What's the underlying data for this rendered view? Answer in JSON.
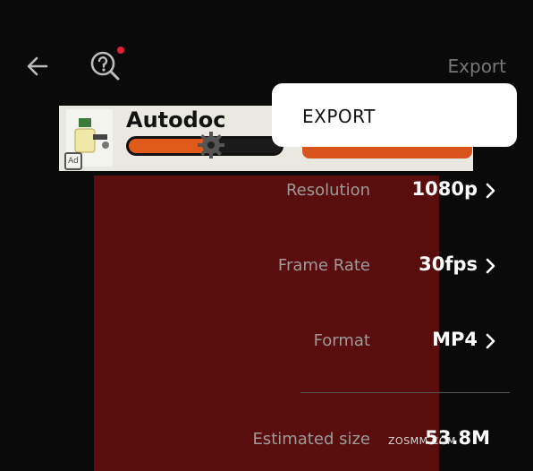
{
  "header": {
    "export_label": "Export",
    "back_icon": "arrow-left-icon",
    "help_icon": "help-search-icon"
  },
  "ad": {
    "title": "Autodoc",
    "badge": "Ad"
  },
  "popup": {
    "label": "EXPORT"
  },
  "settings": [
    {
      "label": "Resolution",
      "value": "1080p"
    },
    {
      "label": "Frame Rate",
      "value": "30fps"
    },
    {
      "label": "Format",
      "value": "MP4"
    }
  ],
  "estimate": {
    "label": "Estimated size",
    "value": "53.8M"
  },
  "watermark": "ZOSMM.COM",
  "colors": {
    "background": "#0a0a0a",
    "preview": "#5a0d0d",
    "notification": "#e3202e",
    "muted_text": "#9b9b9b"
  }
}
